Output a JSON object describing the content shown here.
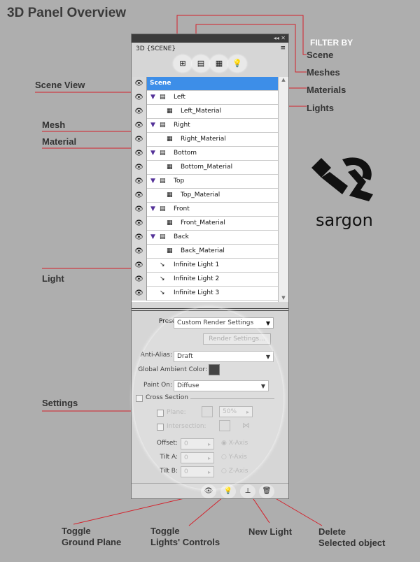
{
  "title": "3D Panel Overview",
  "annotations": {
    "filter_by": "FILTER BY",
    "scene": "Scene",
    "meshes": "Meshes",
    "materials": "Materials",
    "lights": "Lights",
    "scene_view": "Scene View",
    "mesh": "Mesh",
    "material": "Material",
    "light": "Light",
    "settings": "Settings",
    "toggle_ground_plane": [
      "Toggle",
      "Ground Plane"
    ],
    "toggle_lights": [
      "Toggle",
      "Lights' Controls"
    ],
    "new_light": "New Light",
    "delete": [
      "Delete",
      "Selected object"
    ]
  },
  "panel": {
    "title": "3D {SCENE}",
    "titlebar_controls": "◂◂ ✕",
    "filters": [
      {
        "name": "scene-filter-icon",
        "glyph": "⊞"
      },
      {
        "name": "meshes-filter-icon",
        "glyph": "▤"
      },
      {
        "name": "materials-filter-icon",
        "glyph": "▦"
      },
      {
        "name": "lights-filter-icon",
        "glyph": "💡"
      }
    ],
    "rows": [
      {
        "label": "Scene",
        "type": "scene",
        "selected": true
      },
      {
        "label": "Left",
        "type": "mesh"
      },
      {
        "label": "Left_Material",
        "type": "material"
      },
      {
        "label": "Right",
        "type": "mesh"
      },
      {
        "label": "Right_Material",
        "type": "material"
      },
      {
        "label": "Bottom",
        "type": "mesh"
      },
      {
        "label": "Bottom_Material",
        "type": "material"
      },
      {
        "label": "Top",
        "type": "mesh"
      },
      {
        "label": "Top_Material",
        "type": "material"
      },
      {
        "label": "Front",
        "type": "mesh"
      },
      {
        "label": "Front_Material",
        "type": "material"
      },
      {
        "label": "Back",
        "type": "mesh"
      },
      {
        "label": "Back_Material",
        "type": "material"
      },
      {
        "label": "Infinite Light 1",
        "type": "light"
      },
      {
        "label": "Infinite Light 2",
        "type": "light"
      },
      {
        "label": "Infinite Light 3",
        "type": "light"
      }
    ],
    "settings": {
      "preset_label": "Preset:",
      "preset_value": "Custom Render Settings",
      "render_settings": "Render Settings...",
      "anti_alias_label": "Anti-Alias:",
      "anti_alias_value": "Draft",
      "ambient_label": "Global Ambient Color:",
      "ambient_color": "#1a1a1a",
      "paint_on_label": "Paint On:",
      "paint_on_value": "Diffuse",
      "cross_section": "Cross Section",
      "plane": "Plane:",
      "plane_opacity": "50%",
      "intersection": "Intersection:",
      "offset_label": "Offset:",
      "offset_value": "0",
      "tilt_a_label": "Tilt A:",
      "tilt_a_value": "0",
      "tilt_b_label": "Tilt B:",
      "tilt_b_value": "0",
      "x_axis": "X-Axis",
      "y_axis": "Y-Axis",
      "z_axis": "Z-Axis"
    }
  },
  "logo": {
    "text": "sargon"
  },
  "colors": {
    "accent": "#d4202a",
    "selection": "#3d8ee8"
  }
}
